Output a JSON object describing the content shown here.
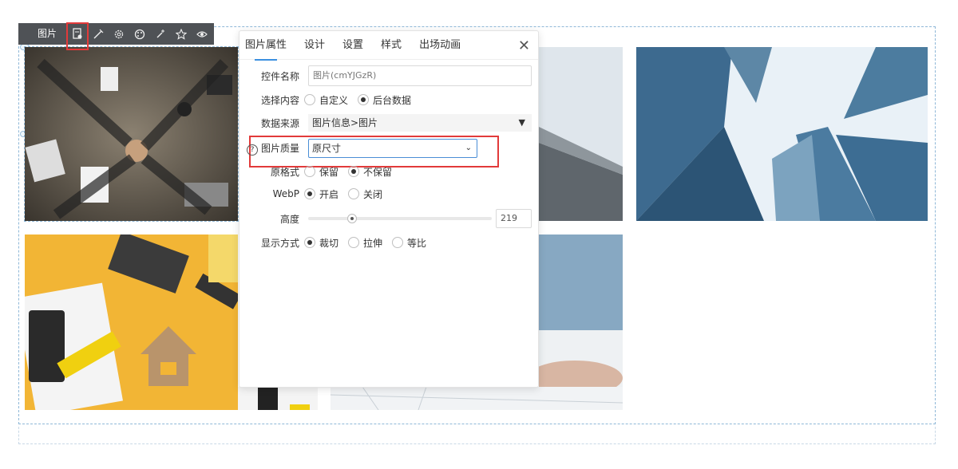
{
  "toolbar": {
    "label": "图片",
    "icons": [
      "settings-doc-icon",
      "magic-wand-icon",
      "gear-icon",
      "palette-icon",
      "sparkle-icon",
      "star-icon",
      "eye-icon"
    ]
  },
  "panel": {
    "tabs": [
      "图片属性",
      "设计",
      "设置",
      "样式",
      "出场动画"
    ],
    "active_tab": "图片属性",
    "close": "✕",
    "control_name": {
      "label": "控件名称",
      "value": "图片(cmYJGzR)"
    },
    "select_content": {
      "label": "选择内容",
      "options": [
        "自定义",
        "后台数据"
      ],
      "selected": "后台数据"
    },
    "data_source": {
      "label": "数据来源",
      "value": "图片信息>图片",
      "arrow": "▼"
    },
    "image_quality": {
      "help": "?",
      "label": "图片质量",
      "value": "原尺寸",
      "chevron": "⌄"
    },
    "original_format": {
      "label": "原格式",
      "options": [
        "保留",
        "不保留"
      ],
      "selected": "不保留"
    },
    "webp": {
      "label": "WebP",
      "options": [
        "开启",
        "关闭"
      ],
      "selected": "开启"
    },
    "height": {
      "label": "高度",
      "value": "219",
      "slider_fraction": 0.24
    },
    "display_mode": {
      "label": "显示方式",
      "options": [
        "裁切",
        "拉伸",
        "等比"
      ],
      "selected": "裁切"
    }
  },
  "colors": {
    "accent": "#3b8fe0",
    "highlight": "#e23a3a",
    "toolbar_bg": "#4f5256"
  }
}
